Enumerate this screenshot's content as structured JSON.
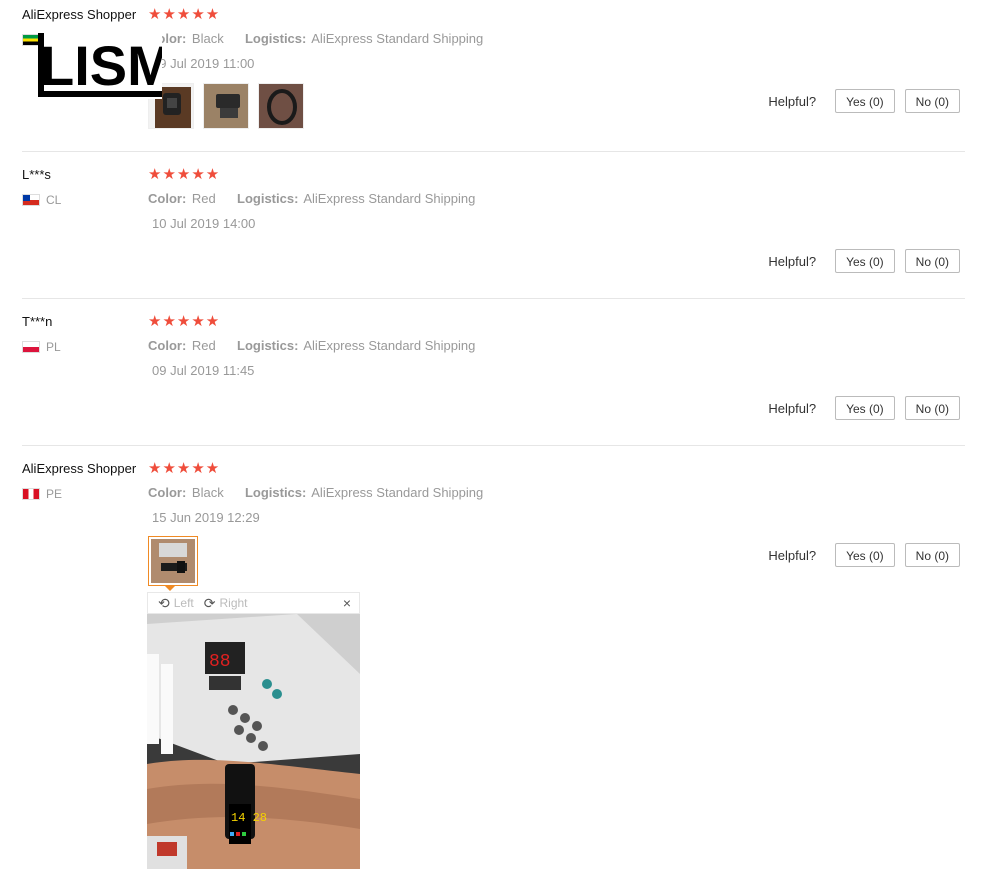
{
  "logo_text": "LISM",
  "reviews": [
    {
      "user": "AliExpress Shopper",
      "country": "MZ",
      "stars": "★★★★★",
      "color_label": "Color:",
      "color": "Black",
      "logistics_label": "Logistics:",
      "logistics": "AliExpress Standard Shipping",
      "date": "19 Jul 2019 11:00",
      "helpful_label": "Helpful?",
      "yes_label": "Yes (0)",
      "no_label": "No (0)"
    },
    {
      "user": "L***s",
      "country": "CL",
      "stars": "★★★★★",
      "color_label": "Color:",
      "color": "Red",
      "logistics_label": "Logistics:",
      "logistics": "AliExpress Standard Shipping",
      "date": "10 Jul 2019 14:00",
      "helpful_label": "Helpful?",
      "yes_label": "Yes (0)",
      "no_label": "No (0)"
    },
    {
      "user": "T***n",
      "country": "PL",
      "stars": "★★★★★",
      "color_label": "Color:",
      "color": "Red",
      "logistics_label": "Logistics:",
      "logistics": "AliExpress Standard Shipping",
      "date": "09 Jul 2019 11:45",
      "helpful_label": "Helpful?",
      "yes_label": "Yes (0)",
      "no_label": "No (0)"
    },
    {
      "user": "AliExpress Shopper",
      "country": "PE",
      "stars": "★★★★★",
      "color_label": "Color:",
      "color": "Black",
      "logistics_label": "Logistics:",
      "logistics": "AliExpress Standard Shipping",
      "date": "15 Jun 2019 12:29",
      "helpful_label": "Helpful?",
      "yes_label": "Yes (0)",
      "no_label": "No (0)"
    }
  ],
  "viewer": {
    "rotate_left_label": "Left",
    "rotate_right_label": "Right",
    "close_glyph": "×",
    "watch_display": "14 28"
  },
  "colors": {
    "star": "#ef4d3b",
    "muted": "#999999",
    "active_thumb_border": "#f08a24"
  }
}
